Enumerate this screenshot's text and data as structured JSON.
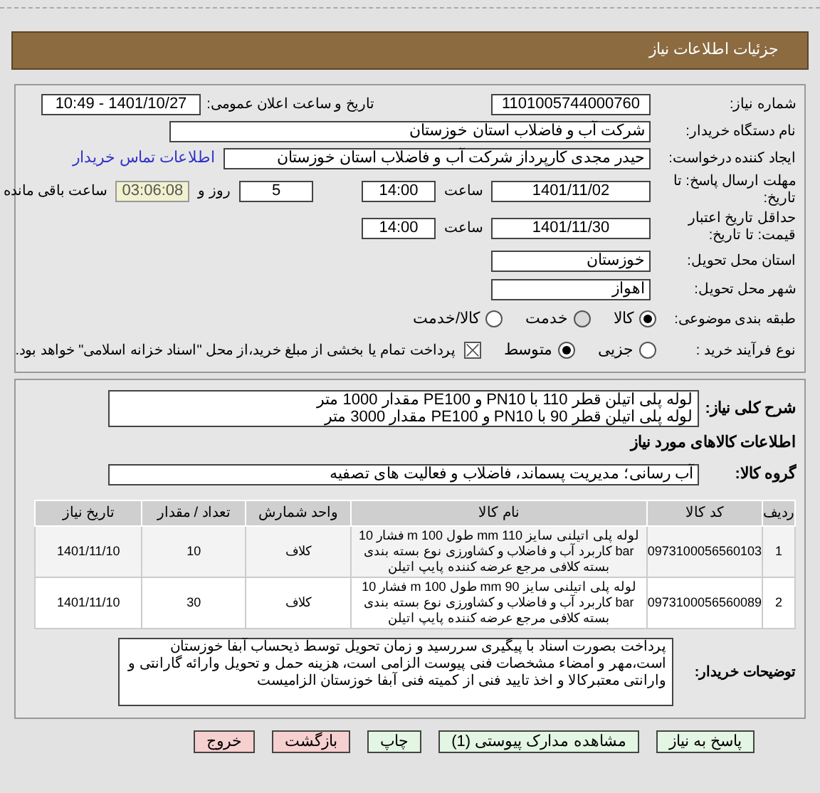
{
  "title": "جزئیات اطلاعات نیاز",
  "need_number": {
    "label": "شماره نیاز:",
    "value": "1101005744000760"
  },
  "announce": {
    "label": "تاریخ و ساعت اعلان عمومی:",
    "value": "1401/10/27 - 10:49"
  },
  "buyer": {
    "label": "نام دستگاه خریدار:",
    "value": "شرکت آب و فاضلاب استان خوزستان"
  },
  "requester": {
    "label": "ایجاد کننده درخواست:",
    "value": "حیدر مجدی کارپرداز شرکت آب و فاضلاب استان خوزستان",
    "link": "اطلاعات تماس خریدار"
  },
  "reply_deadline": {
    "label": "مهلت ارسال پاسخ: تا تاریخ:",
    "date": "1401/11/02",
    "time_label": "ساعت",
    "time": "14:00",
    "days": "5",
    "days_label": "روز و",
    "remaining": "03:06:08",
    "remaining_label": "ساعت باقی مانده"
  },
  "price_validity": {
    "label": "حداقل تاریخ اعتبار قیمت: تا تاریخ:",
    "date": "1401/11/30",
    "time_label": "ساعت",
    "time": "14:00"
  },
  "province": {
    "label": "استان محل تحویل:",
    "value": "خوزستان"
  },
  "city": {
    "label": "شهر محل تحویل:",
    "value": "اهواز"
  },
  "category": {
    "label": "طبقه بندی موضوعی:",
    "options": [
      {
        "label": "کالا",
        "selected": true,
        "disabled": false
      },
      {
        "label": "خدمت",
        "selected": false,
        "disabled": true
      },
      {
        "label": "کالا/خدمت",
        "selected": false,
        "disabled": false
      }
    ]
  },
  "process": {
    "label": "نوع فرآیند خرید :",
    "options": [
      {
        "label": "جزیی",
        "selected": false
      },
      {
        "label": "متوسط",
        "selected": true
      }
    ],
    "treasury": {
      "checked": true,
      "text": "پرداخت تمام یا بخشی از مبلغ خرید،از محل \"اسناد خزانه اسلامی\" خواهد بود."
    }
  },
  "description": {
    "label": "شرح کلی نیاز:",
    "lines": [
      "لوله پلی اتیلن قطر 110 با PN10 و PE100 مقدار 1000 متر",
      "لوله پلی اتیلن قطر 90 با PN10 و PE100  مقدار 3000 متر"
    ]
  },
  "goods_heading": "اطلاعات کالاهای مورد نیاز",
  "goods_group": {
    "label": "گروه کالا:",
    "value": "آب رسانی؛ مدیریت پسماند، فاضلاب و فعالیت های تصفیه"
  },
  "table": {
    "columns": [
      "ردیف",
      "کد کالا",
      "نام کالا",
      "واحد شمارش",
      "تعداد / مقدار",
      "تاریخ نیاز"
    ],
    "rows": [
      [
        "1",
        "0973100056560103",
        "لوله پلی اتیلنی سایز 110 mm طول 100 m فشار 10 bar کاربرد آب و فاضلاب و کشاورزی نوع بسته بندی بسته کلافی مرجع عرضه کننده پایپ اتیلن",
        "کلاف",
        "10",
        "1401/11/10"
      ],
      [
        "2",
        "0973100056560089",
        "لوله پلی اتیلنی سایز 90 mm طول 100 m فشار 10 bar کاربرد آب و فاضلاب و کشاورزی نوع بسته بندی بسته کلافی مرجع عرضه کننده پایپ اتیلن",
        "کلاف",
        "30",
        "1401/11/10"
      ]
    ]
  },
  "buyer_notes": {
    "label": "توضیحات خریدار:",
    "text": "پرداخت بصورت اسناد با پیگیری  سررسید و زمان تحویل توسط ذیحساب آبفا خوزستان است،مهر و امضاء مشخصات فنی پیوست الزامی است، هزینه حمل و تحویل وارائه گارانتی و وارانتی معتبرکالا و اخذ تایید فنی از کمیته فنی آبفا خوزستان الزامیست"
  },
  "buttons": [
    {
      "label": "پاسخ به نیاز",
      "kind": "primary"
    },
    {
      "label": "مشاهده مدارک پیوستی (1)",
      "kind": "primary"
    },
    {
      "label": "چاپ",
      "kind": "primary"
    },
    {
      "label": "بازگشت",
      "kind": "danger"
    },
    {
      "label": "خروج",
      "kind": "danger"
    }
  ]
}
